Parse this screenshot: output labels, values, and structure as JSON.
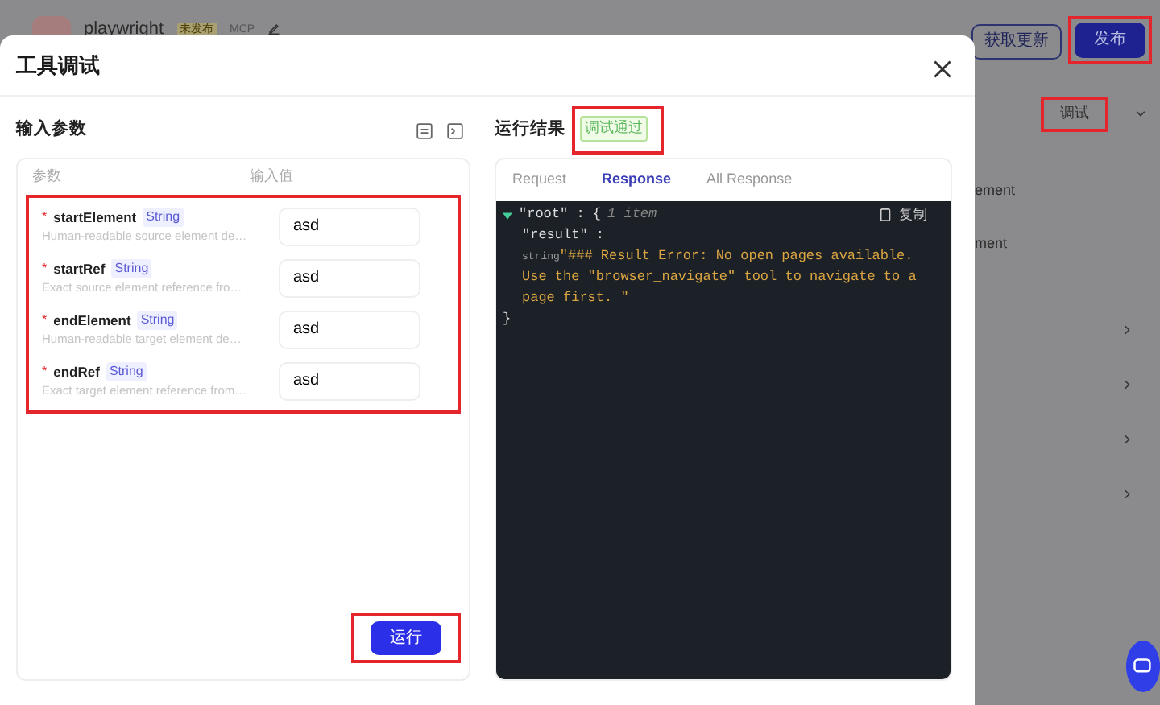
{
  "background_page": {
    "app_name": "playwright",
    "status_badge": "未发布",
    "type_label": "MCP",
    "buttons": [
      {
        "label": "获取更新",
        "kind": "outline",
        "highlighted": false
      },
      {
        "label": "发布",
        "kind": "primary",
        "highlighted": true
      }
    ],
    "debug_button": {
      "label": "调试",
      "highlighted": true
    },
    "tool_names": [
      "ement",
      "ment"
    ],
    "sections": [
      {
        "expanded": false
      },
      {
        "expanded": false
      },
      {
        "expanded": false
      },
      {
        "expanded": false
      }
    ]
  },
  "modal": {
    "title": "工具调试",
    "input_panel": {
      "title": "输入参数",
      "columns": [
        "参数",
        "输入值"
      ],
      "params_highlighted": true,
      "params": [
        {
          "name": "startElement",
          "type": "String",
          "required_mark": "*",
          "description": "Human-readable source element de…",
          "value": "asd"
        },
        {
          "name": "startRef",
          "type": "String",
          "required_mark": "*",
          "description": "Exact source element reference fro…",
          "value": "asd"
        },
        {
          "name": "endElement",
          "type": "String",
          "required_mark": "*",
          "description": "Human-readable target element de…",
          "value": "asd"
        },
        {
          "name": "endRef",
          "type": "String",
          "required_mark": "*",
          "description": "Exact target element reference from…",
          "value": "asd"
        }
      ],
      "run_button": {
        "label": "运行",
        "highlighted": true
      }
    },
    "result_panel": {
      "title": "运行结果",
      "status": "调试通过",
      "status_highlighted": true,
      "tabs": [
        {
          "label": "Request",
          "selected": false
        },
        {
          "label": "Response",
          "selected": true
        },
        {
          "label": "All Response",
          "selected": false
        }
      ],
      "copy_label": "复制",
      "code": {
        "expanded": true,
        "root_line": "\"root\" : {",
        "item_count": "1 item",
        "entries": [
          {
            "key": "\"result\" :",
            "type": "string",
            "value": "\"### Result Error: No open pages available. Use the \"browser_navigate\" tool to navigate to a page first. \""
          }
        ],
        "close_brace": "}"
      }
    }
  }
}
